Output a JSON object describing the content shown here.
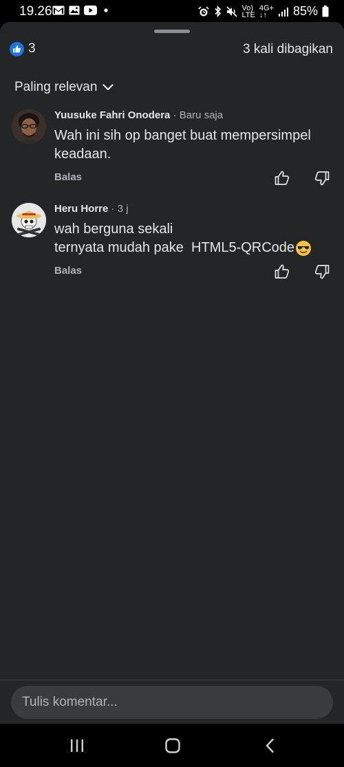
{
  "status": {
    "time": "19.26",
    "battery": "85%",
    "volte": "Vo)",
    "lte": "LTE",
    "net": "4G+"
  },
  "reactions": {
    "count": "3",
    "shares": "3 kali dibagikan"
  },
  "sort": {
    "label": "Paling relevan"
  },
  "comments": [
    {
      "name": "Yuusuke Fahri Onodera",
      "time": "· Baru saja",
      "text": "Wah ini sih op banget buat mempersimpel keadaan.",
      "reply": "Balas"
    },
    {
      "name": "Heru Horre",
      "time": "· 3 j",
      "line1": "wah berguna sekali",
      "line2": "ternyata mudah pake  HTML5-QRCode",
      "reply": "Balas"
    }
  ],
  "composer": {
    "placeholder": "Tulis komentar..."
  }
}
